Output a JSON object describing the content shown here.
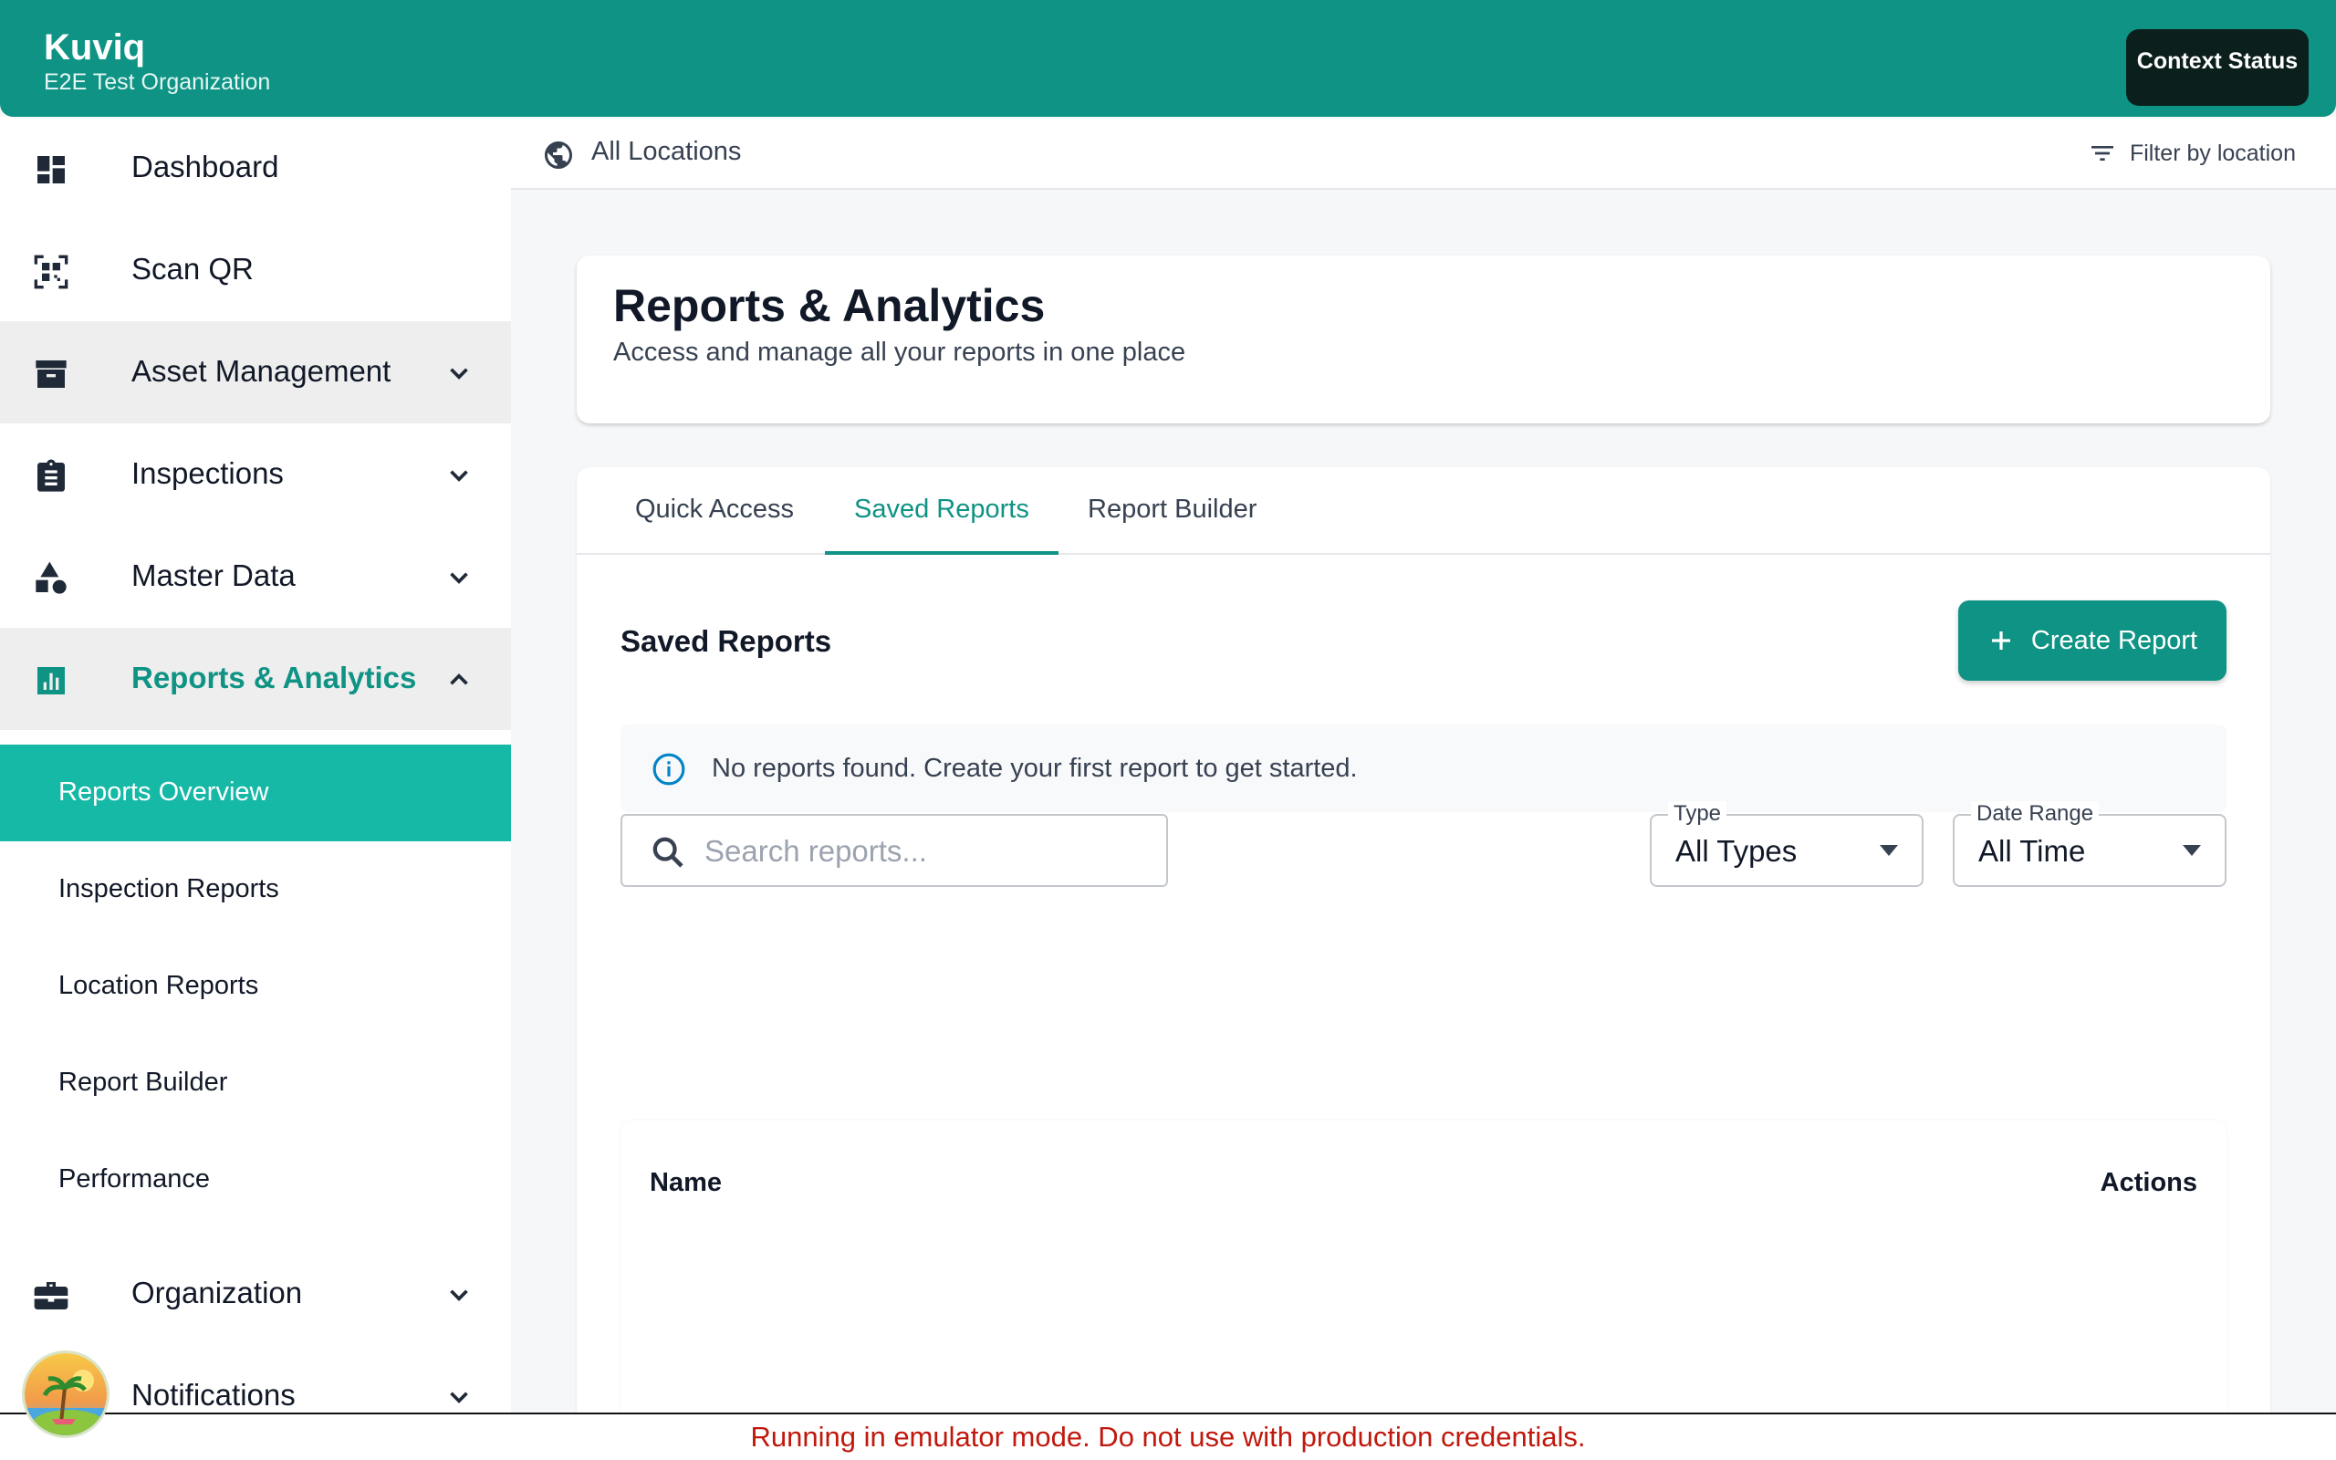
{
  "header": {
    "app_name": "Kuviq",
    "org_name": "E2E Test Organization",
    "context_status_label": "Context Status"
  },
  "sidebar": {
    "items": [
      {
        "label": "Dashboard",
        "icon": "dashboard-icon"
      },
      {
        "label": "Scan QR",
        "icon": "qr-scan-icon"
      },
      {
        "label": "Asset Management",
        "icon": "archive-icon",
        "expandable": true
      },
      {
        "label": "Inspections",
        "icon": "clipboard-icon",
        "expandable": true
      },
      {
        "label": "Master Data",
        "icon": "shapes-icon",
        "expandable": true
      },
      {
        "label": "Reports & Analytics",
        "icon": "bar-chart-icon",
        "expandable": true,
        "expanded": true,
        "active": true
      },
      {
        "label": "Organization",
        "icon": "briefcase-icon",
        "expandable": true
      },
      {
        "label": "Notifications",
        "icon": "bell-icon",
        "expandable": true
      }
    ],
    "sub_items": [
      {
        "label": "Reports Overview",
        "selected": true
      },
      {
        "label": "Inspection Reports"
      },
      {
        "label": "Location Reports"
      },
      {
        "label": "Report Builder"
      },
      {
        "label": "Performance"
      }
    ]
  },
  "location_bar": {
    "label": "All Locations",
    "filter_label": "Filter by location"
  },
  "page": {
    "title": "Reports & Analytics",
    "subtitle": "Access and manage all your reports in one place"
  },
  "tabs": [
    {
      "label": "Quick Access"
    },
    {
      "label": "Saved Reports",
      "active": true
    },
    {
      "label": "Report Builder"
    }
  ],
  "saved_reports": {
    "section_title": "Saved Reports",
    "create_label": "Create Report",
    "info_message": "No reports found. Create your first report to get started.",
    "search_placeholder": "Search reports...",
    "type_filter": {
      "legend": "Type",
      "value": "All Types"
    },
    "date_filter": {
      "legend": "Date Range",
      "value": "All Time"
    },
    "table": {
      "columns": [
        "Name",
        "Actions"
      ],
      "rows": []
    }
  },
  "banner": {
    "text": "Running in emulator mode. Do not use with production credentials."
  },
  "colors": {
    "brand": "#0e9384",
    "selected_sub_item": "#16b8a6",
    "banner_text": "#c0180c"
  }
}
